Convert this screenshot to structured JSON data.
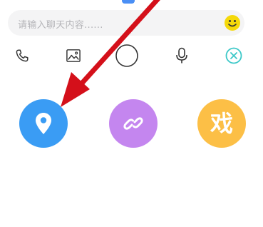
{
  "chat_input": {
    "placeholder": "请输入聊天内容......"
  },
  "toolbar": {
    "icons": [
      "phone-icon",
      "image-icon",
      "circle-button-icon",
      "microphone-icon",
      "close-icon"
    ]
  },
  "actions": {
    "game_label": "戏"
  },
  "colors": {
    "location": "#3a9cf4",
    "link": "#c486ef",
    "game": "#fcbf46",
    "emoji": "#f5d90a",
    "close": "#3cc8c8",
    "arrow": "#d4101a",
    "input_bg": "#f4f4f5"
  }
}
